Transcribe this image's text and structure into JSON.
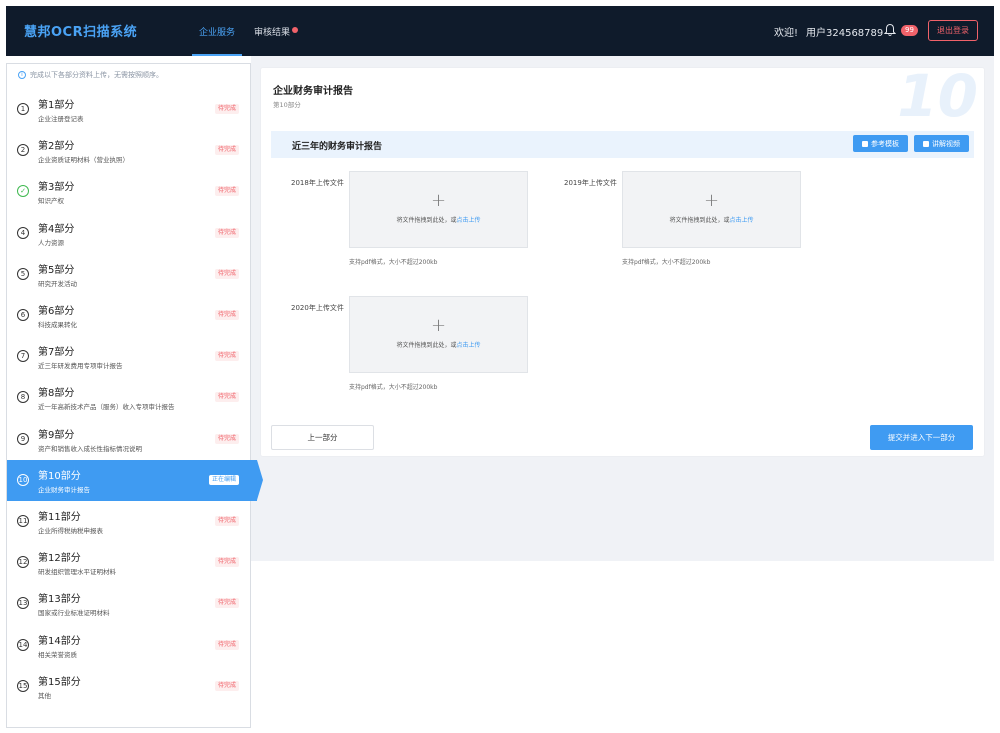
{
  "header": {
    "brand": "慧邦OCR扫描系统",
    "tabs": [
      {
        "label": "企业服务",
        "active": true
      },
      {
        "label": "审核结果",
        "active": false,
        "dot": true
      }
    ],
    "welcome": "欢迎!",
    "username": "用户324568789",
    "notification_count": "99",
    "logout_label": "退出登录"
  },
  "sidebar": {
    "hint": "完成以下各部分资料上传，无需按照顺序。",
    "sections": [
      {
        "num": "1",
        "title": "第1部分",
        "sub": "企业注册登记表",
        "status": "待完成",
        "state": "pending"
      },
      {
        "num": "2",
        "title": "第2部分",
        "sub": "企业资质证明材料（营业执照）",
        "status": "待完成",
        "state": "pending"
      },
      {
        "num": "✓",
        "title": "第3部分",
        "sub": "知识产权",
        "status": "待完成",
        "state": "done"
      },
      {
        "num": "4",
        "title": "第4部分",
        "sub": "人力资源",
        "status": "待完成",
        "state": "pending"
      },
      {
        "num": "5",
        "title": "第5部分",
        "sub": "研究开发活动",
        "status": "待完成",
        "state": "pending"
      },
      {
        "num": "6",
        "title": "第6部分",
        "sub": "科技成果转化",
        "status": "待完成",
        "state": "pending"
      },
      {
        "num": "7",
        "title": "第7部分",
        "sub": "近三年研发费用专项审计报告",
        "status": "待完成",
        "state": "pending"
      },
      {
        "num": "8",
        "title": "第8部分",
        "sub": "近一年高新技术产品（服务）收入专项审计报告",
        "status": "待完成",
        "state": "pending"
      },
      {
        "num": "9",
        "title": "第9部分",
        "sub": "资产和销售收入成长性指标情况说明",
        "status": "待完成",
        "state": "pending"
      },
      {
        "num": "10",
        "title": "第10部分",
        "sub": "企业财务审计报告",
        "status": "正在编辑",
        "state": "active"
      },
      {
        "num": "11",
        "title": "第11部分",
        "sub": "企业所得税纳税申报表",
        "status": "待完成",
        "state": "pending"
      },
      {
        "num": "12",
        "title": "第12部分",
        "sub": "研发组织管理水平证明材料",
        "status": "待完成",
        "state": "pending"
      },
      {
        "num": "13",
        "title": "第13部分",
        "sub": "国家或行业标准证明材料",
        "status": "待完成",
        "state": "pending"
      },
      {
        "num": "14",
        "title": "第14部分",
        "sub": "相关荣誉资质",
        "status": "待完成",
        "state": "pending"
      },
      {
        "num": "15",
        "title": "第15部分",
        "sub": "其他",
        "status": "待完成",
        "state": "pending"
      }
    ]
  },
  "main": {
    "title": "企业财务审计报告",
    "subtitle": "第10部分",
    "watermark": "10",
    "bar_title": "近三年的财务审计报告",
    "template_btn": "参考模板",
    "video_btn": "讲解视频",
    "uploads": [
      {
        "label": "2018年上传文件",
        "dz_text": "将文件拖拽到此处，或",
        "dz_link": "点击上传",
        "tip": "支持pdf格式，大小不超过200kb"
      },
      {
        "label": "2019年上传文件",
        "dz_text": "将文件拖拽到此处，或",
        "dz_link": "点击上传",
        "tip": "支持pdf格式，大小不超过200kb"
      },
      {
        "label": "2020年上传文件",
        "dz_text": "将文件拖拽到此处，或",
        "dz_link": "点击上传",
        "tip": "支持pdf格式，大小不超过200kb"
      }
    ],
    "plus": "+",
    "prev_label": "上一部分",
    "next_label": "提交并进入下一部分"
  }
}
